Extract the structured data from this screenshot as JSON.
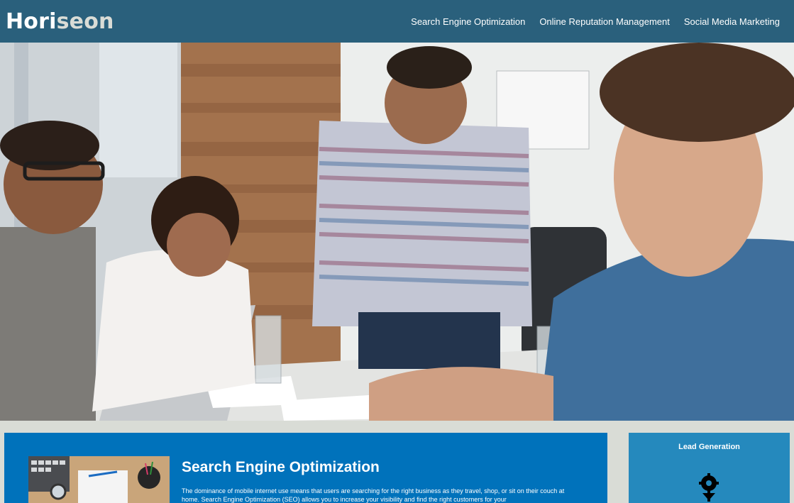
{
  "header": {
    "logo_main": "Hori",
    "logo_accent": "seon",
    "nav": [
      {
        "label": "Search Engine Optimization"
      },
      {
        "label": "Online Reputation Management"
      },
      {
        "label": "Social Media Marketing"
      }
    ]
  },
  "hero": {
    "image_alt": "team-meeting-photo"
  },
  "content": {
    "title": "Search Engine Optimization",
    "text": "The dominance of mobile internet use means that users are searching for the right business as they travel, shop, or sit on their couch at home. Search Engine Optimization (SEO) allows you to increase your visibility and find the right customers for your"
  },
  "sidebar": {
    "title": "Lead Generation"
  },
  "colors": {
    "header_bg": "#2a607c",
    "content_bg": "#0072bb",
    "sidebar_bg": "#2589bd",
    "page_bg": "#d9dcd6"
  }
}
